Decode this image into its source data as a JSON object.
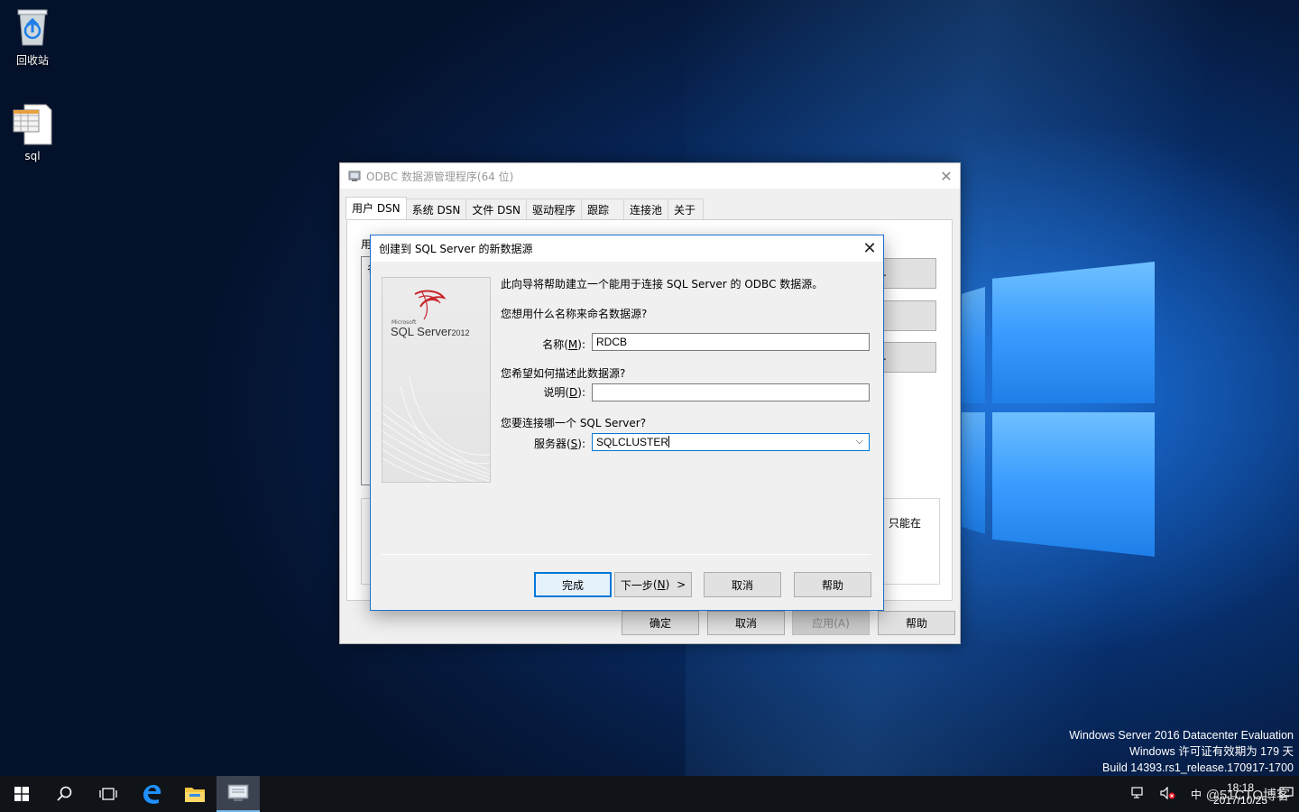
{
  "desktop": {
    "icons": [
      {
        "label": "回收站",
        "icon": "recycle-bin-icon"
      },
      {
        "label": "sql",
        "icon": "sql-file-icon"
      }
    ],
    "watermark": {
      "line1": "Windows Server 2016 Datacenter Evaluation",
      "line2": "Windows 许可证有效期为 179 天",
      "line3": "Build 14393.rs1_release.170917-1700"
    }
  },
  "odbc_window": {
    "title": "ODBC 数据源管理程序(64 位)",
    "tabs": [
      "用户 DSN",
      "系统 DSN",
      "文件 DSN",
      "驱动程序",
      "跟踪",
      "连接池",
      "关于"
    ],
    "active_tab": 0,
    "partial_label": "用",
    "partial_col": "名",
    "partial_btn1": ".",
    "partial_btn3": ".",
    "partial_info": "只能在",
    "buttons": {
      "ok": "确定",
      "cancel": "取消",
      "apply": "应用(A)",
      "help": "帮助"
    }
  },
  "wizard": {
    "title": "创建到 SQL Server 的新数据源",
    "banner": {
      "ms": "Microsoft",
      "brand": "SQL Server",
      "year": "2012"
    },
    "intro": "此向导将帮助建立一个能用于连接 SQL Server 的 ODBC 数据源。",
    "q_name": "您想用什么名称来命名数据源?",
    "name_label": "名称",
    "name_key": "M",
    "name_value": "RDCB",
    "q_desc": "您希望如何描述此数据源?",
    "desc_label": "说明",
    "desc_key": "D",
    "desc_value": "",
    "q_server": "您要连接哪一个 SQL Server?",
    "server_label": "服务器",
    "server_key": "S",
    "server_value": "SQLCLUSTER",
    "buttons": {
      "finish": "完成",
      "next": "下一步",
      "next_key": "N",
      "next_arrow": ">",
      "cancel": "取消",
      "help": "帮助"
    }
  },
  "taskbar": {
    "items": [
      "start-icon",
      "search-icon",
      "task-view-icon",
      "edge-icon",
      "file-explorer-icon",
      "odbc-app-icon"
    ],
    "ime": "中",
    "time": "18:18",
    "date": "2017/10/25",
    "watermark": "@51CTO博客"
  },
  "colors": {
    "accent": "#0078d7",
    "taskbar": "#101418"
  }
}
